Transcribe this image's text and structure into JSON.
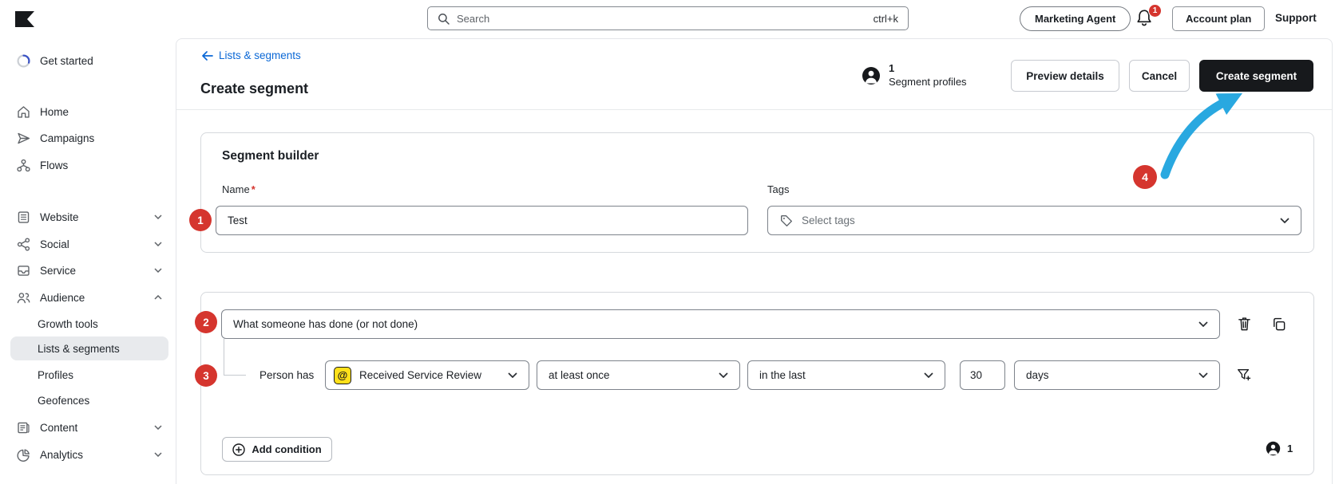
{
  "topbar": {
    "search_placeholder": "Search",
    "search_shortcut": "ctrl+k",
    "agent_button": "Marketing Agent",
    "notification_badge": "1",
    "account_plan_button": "Account plan",
    "support_link": "Support"
  },
  "sidebar": {
    "get_started": "Get started",
    "home": "Home",
    "campaigns": "Campaigns",
    "flows": "Flows",
    "website": "Website",
    "social": "Social",
    "service": "Service",
    "audience": "Audience",
    "growth_tools": "Growth tools",
    "lists_segments": "Lists & segments",
    "profiles": "Profiles",
    "geofences": "Geofences",
    "content": "Content",
    "analytics": "Analytics"
  },
  "header": {
    "back_link": "Lists & segments",
    "title": "Create segment",
    "profile_count": "1",
    "profile_label": "Segment profiles",
    "preview_button": "Preview details",
    "cancel_button": "Cancel",
    "create_button": "Create segment"
  },
  "builder": {
    "title": "Segment builder",
    "name_label": "Name",
    "required_mark": "*",
    "name_value": "Test",
    "tags_label": "Tags",
    "tags_placeholder": "Select tags"
  },
  "condition": {
    "type_value": "What someone has done (or not done)",
    "person_has": "Person has",
    "event_icon_glyph": "@",
    "event_value": "Received Service Review",
    "frequency_value": "at least once",
    "timeframe_value": "in the last",
    "quantity_value": "30",
    "unit_value": "days",
    "add_button": "Add condition",
    "count_value": "1"
  },
  "annotations": {
    "step1": "1",
    "step2": "2",
    "step3": "3",
    "step4": "4"
  },
  "colors": {
    "accent_red": "#d5352e",
    "arrow_blue": "#29a8e0",
    "link_blue": "#0b68d6",
    "event_yellow": "#ffe01a",
    "button_dark": "#17191c"
  }
}
